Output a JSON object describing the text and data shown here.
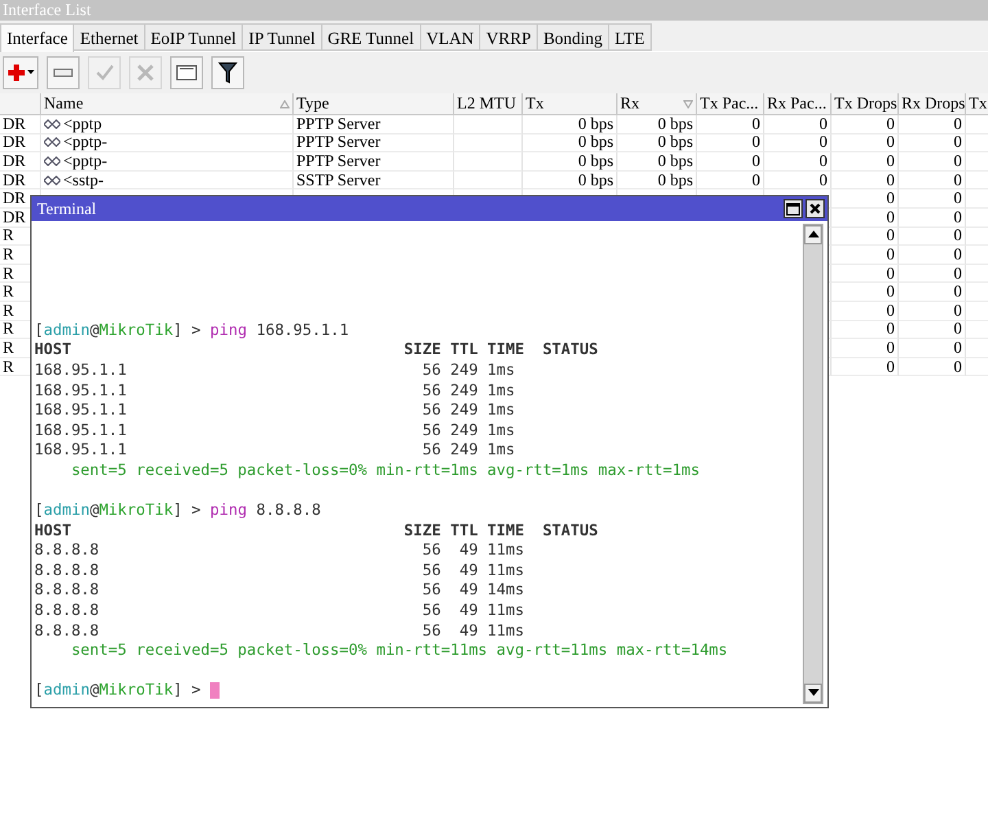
{
  "window": {
    "title": "Interface List"
  },
  "tabs": [
    {
      "label": "Interface",
      "selected": true
    },
    {
      "label": "Ethernet",
      "selected": false
    },
    {
      "label": "EoIP Tunnel",
      "selected": false
    },
    {
      "label": "IP Tunnel",
      "selected": false
    },
    {
      "label": "GRE Tunnel",
      "selected": false
    },
    {
      "label": "VLAN",
      "selected": false
    },
    {
      "label": "VRRP",
      "selected": false
    },
    {
      "label": "Bonding",
      "selected": false
    },
    {
      "label": "LTE",
      "selected": false
    }
  ],
  "toolbar": [
    {
      "kind": "add",
      "disabled": false
    },
    {
      "kind": "remove",
      "disabled": false
    },
    {
      "kind": "enable",
      "disabled": true
    },
    {
      "kind": "disable",
      "disabled": true
    },
    {
      "kind": "comment",
      "disabled": false
    },
    {
      "kind": "filter",
      "disabled": false
    }
  ],
  "table": {
    "columns": [
      "",
      "Name",
      "Type",
      "L2 MTU",
      "Tx",
      "Rx",
      "Tx Pac...",
      "Rx Pac...",
      "Tx Drops",
      "Rx Drops",
      "Tx"
    ],
    "rows": [
      {
        "flags": "DR",
        "name": "<pptp",
        "type": "PPTP Server",
        "tx": "0 bps",
        "rx": "0 bps",
        "tx_packets": "0",
        "rx_packets": "0",
        "tx_drops": "0",
        "rx_drops": "0"
      },
      {
        "flags": "DR",
        "name": "<pptp-",
        "type": "PPTP Server",
        "tx": "0 bps",
        "rx": "0 bps",
        "tx_packets": "0",
        "rx_packets": "0",
        "tx_drops": "0",
        "rx_drops": "0"
      },
      {
        "flags": "DR",
        "name": "<pptp-",
        "type": "PPTP Server",
        "tx": "0 bps",
        "rx": "0 bps",
        "tx_packets": "0",
        "rx_packets": "0",
        "tx_drops": "0",
        "rx_drops": "0"
      },
      {
        "flags": "DR",
        "name": "<sstp-",
        "type": "SSTP Server",
        "tx": "0 bps",
        "rx": "0 bps",
        "tx_packets": "0",
        "rx_packets": "0",
        "tx_drops": "0",
        "rx_drops": "0"
      },
      {
        "flags": "DR",
        "tx_drops": "0",
        "rx_drops": "0"
      },
      {
        "flags": "DR",
        "tx_drops": "0",
        "rx_drops": "0"
      },
      {
        "flags": "R",
        "tx_drops": "0",
        "rx_drops": "0"
      },
      {
        "flags": "R",
        "tx_drops": "0",
        "rx_drops": "0"
      },
      {
        "flags": "R",
        "tx_drops": "0",
        "rx_drops": "0"
      },
      {
        "flags": "R",
        "tx_drops": "0",
        "rx_drops": "0"
      },
      {
        "flags": "R",
        "tx_drops": "0",
        "rx_drops": "0"
      },
      {
        "flags": "R",
        "tx_drops": "0",
        "rx_drops": "0"
      },
      {
        "flags": "R",
        "tx_drops": "0",
        "rx_drops": "0"
      },
      {
        "flags": "R",
        "tx_drops": "0",
        "rx_drops": "0"
      }
    ]
  },
  "terminal": {
    "title": "Terminal",
    "lines": [
      {
        "kind": "command",
        "segments": [
          {
            "kind": "plain",
            "text": "["
          },
          {
            "kind": "user",
            "text": "admin"
          },
          {
            "kind": "plain",
            "text": "@"
          },
          {
            "kind": "host",
            "text": "MikroTik"
          },
          {
            "kind": "plain",
            "text": "] > "
          },
          {
            "kind": "command",
            "text": "ping"
          },
          {
            "kind": "plain",
            "text": " 168.95.1.1"
          }
        ]
      },
      {
        "kind": "header",
        "text": "HOST                                    SIZE TTL TIME  STATUS"
      },
      {
        "kind": "reply",
        "text": "168.95.1.1                                56 249 1ms"
      },
      {
        "kind": "reply",
        "text": "168.95.1.1                                56 249 1ms"
      },
      {
        "kind": "reply",
        "text": "168.95.1.1                                56 249 1ms"
      },
      {
        "kind": "reply",
        "text": "168.95.1.1                                56 249 1ms"
      },
      {
        "kind": "reply",
        "text": "168.95.1.1                                56 249 1ms"
      },
      {
        "kind": "summary",
        "text": "    sent=5 received=5 packet-loss=0% min-rtt=1ms avg-rtt=1ms max-rtt=1ms"
      },
      {
        "kind": "blank"
      },
      {
        "kind": "command",
        "segments": [
          {
            "kind": "plain",
            "text": "["
          },
          {
            "kind": "user",
            "text": "admin"
          },
          {
            "kind": "plain",
            "text": "@"
          },
          {
            "kind": "host",
            "text": "MikroTik"
          },
          {
            "kind": "plain",
            "text": "] > "
          },
          {
            "kind": "command",
            "text": "ping"
          },
          {
            "kind": "plain",
            "text": " 8.8.8.8"
          }
        ]
      },
      {
        "kind": "header",
        "text": "HOST                                    SIZE TTL TIME  STATUS"
      },
      {
        "kind": "reply",
        "text": "8.8.8.8                                   56  49 11ms"
      },
      {
        "kind": "reply",
        "text": "8.8.8.8                                   56  49 11ms"
      },
      {
        "kind": "reply",
        "text": "8.8.8.8                                   56  49 14ms"
      },
      {
        "kind": "reply",
        "text": "8.8.8.8                                   56  49 11ms"
      },
      {
        "kind": "reply",
        "text": "8.8.8.8                                   56  49 11ms"
      },
      {
        "kind": "summary",
        "text": "    sent=5 received=5 packet-loss=0% min-rtt=11ms avg-rtt=11ms max-rtt=14ms"
      },
      {
        "kind": "blank"
      },
      {
        "kind": "prompt",
        "cursor": true,
        "segments": [
          {
            "kind": "plain",
            "text": "["
          },
          {
            "kind": "user",
            "text": "admin"
          },
          {
            "kind": "plain",
            "text": "@"
          },
          {
            "kind": "host",
            "text": "MikroTik"
          },
          {
            "kind": "plain",
            "text": "] > "
          }
        ]
      }
    ]
  }
}
